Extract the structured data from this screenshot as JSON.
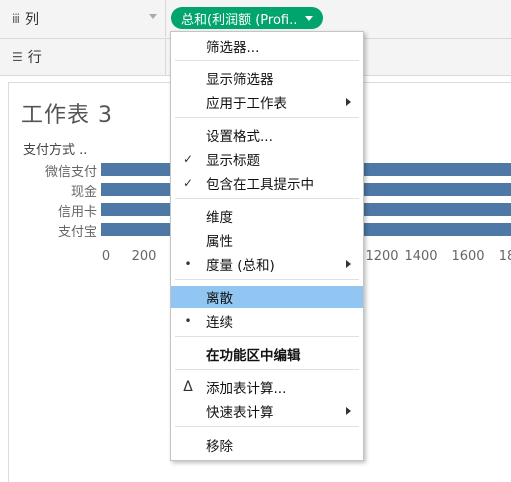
{
  "shelves": {
    "columns": {
      "icon": "columns-icon",
      "label": "列",
      "pill": "总和(利润额 (Profi.."
    },
    "rows": {
      "icon": "rows-icon",
      "label": "行"
    }
  },
  "sheet": {
    "title": "工作表 3",
    "header": "支付方式 ..",
    "categories": [
      "微信支付",
      "现金",
      "信用卡",
      "支付宝"
    ],
    "axis_ticks": [
      "0",
      "200",
      "1200",
      "1400",
      "1600",
      "18"
    ],
    "bar_color": "#4e79a7"
  },
  "menu": {
    "items": [
      {
        "label": "筛选器...",
        "mark": "",
        "submenu": false
      },
      {
        "label": "显示筛选器",
        "mark": "",
        "submenu": false
      },
      {
        "label": "应用于工作表",
        "mark": "",
        "submenu": true
      },
      {
        "label": "设置格式...",
        "mark": "",
        "submenu": false
      },
      {
        "label": "显示标题",
        "mark": "✓",
        "submenu": false
      },
      {
        "label": "包含在工具提示中",
        "mark": "✓",
        "submenu": false
      },
      {
        "label": "维度",
        "mark": "",
        "submenu": false
      },
      {
        "label": "属性",
        "mark": "",
        "submenu": false
      },
      {
        "label": "度量 (总和)",
        "mark": "•",
        "submenu": true
      },
      {
        "label": "离散",
        "mark": "",
        "submenu": false,
        "highlighted": true
      },
      {
        "label": "连续",
        "mark": "•",
        "submenu": false
      },
      {
        "label": "在功能区中编辑",
        "mark": "",
        "submenu": false,
        "bold": true
      },
      {
        "label": "添加表计算...",
        "mark": "Δ",
        "submenu": false
      },
      {
        "label": "快速表计算",
        "mark": "",
        "submenu": true
      },
      {
        "label": "移除",
        "mark": "",
        "submenu": false
      }
    ]
  },
  "colors": {
    "pill": "#00a46c",
    "highlight": "#91c5f2",
    "bar": "#4e79a7"
  }
}
